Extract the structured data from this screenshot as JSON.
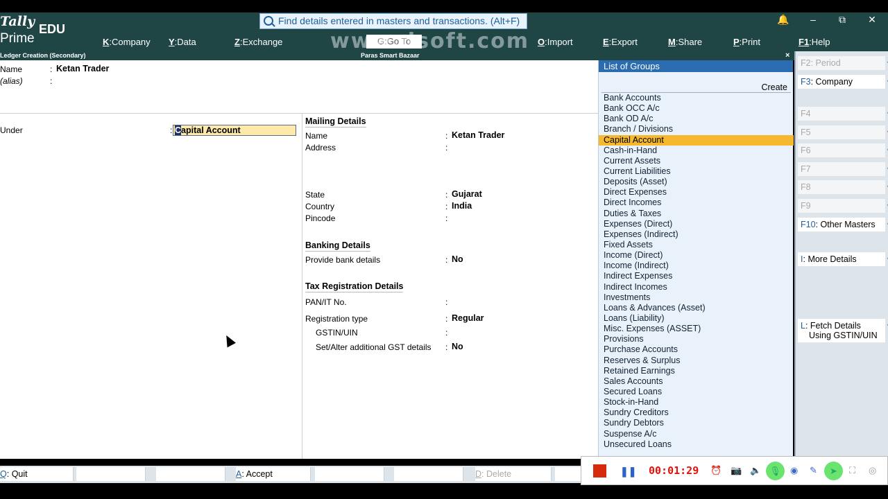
{
  "app": {
    "logo_top": "Tally",
    "logo_edu": "EDU",
    "logo_bottom": "Prime",
    "watermark": "www.dsoft.com"
  },
  "search": {
    "placeholder": "Find details entered in masters and transactions. (Alt+F)"
  },
  "window_controls": {
    "bell": "🔔",
    "minimize": "–",
    "restore": "⧉",
    "close": "✕"
  },
  "menu": [
    {
      "key": "K",
      "label": "Company"
    },
    {
      "key": "Y",
      "label": "Data"
    },
    {
      "key": "Z",
      "label": "Exchange"
    },
    {
      "key": "G",
      "label": "Go To"
    },
    {
      "key": "O",
      "label": "Import"
    },
    {
      "key": "E",
      "label": "Export"
    },
    {
      "key": "M",
      "label": "Share"
    },
    {
      "key": "P",
      "label": "Print"
    },
    {
      "key": "F1",
      "label": "Help"
    }
  ],
  "subheader": {
    "screen_title": "Ledger Creation (Secondary)",
    "company": "Paras Smart Bazaar",
    "close": "×"
  },
  "ledger": {
    "name_label": "Name",
    "name_value": "Ketan Trader",
    "alias_label": "(alias)",
    "under_label": "Under",
    "under_value_first": "C",
    "under_value_rest": "apital Account"
  },
  "mailing": {
    "heading": "Mailing Details",
    "name_label": "Name",
    "name_value": "Ketan Trader",
    "address_label": "Address",
    "state_label": "State",
    "state_value": "Gujarat",
    "country_label": "Country",
    "country_value": "India",
    "pincode_label": "Pincode"
  },
  "banking": {
    "heading": "Banking Details",
    "provide_label": "Provide bank details",
    "provide_value": "No"
  },
  "tax": {
    "heading": "Tax Registration Details",
    "pan_label": "PAN/IT No.",
    "regtype_label": "Registration type",
    "regtype_value": "Regular",
    "gstin_label": "GSTIN/UIN",
    "gst_details_label": "Set/Alter additional GST details",
    "gst_details_value": "No"
  },
  "groups": {
    "title": "List of Groups",
    "create": "Create",
    "selected": "Capital Account",
    "items": [
      "Bank Accounts",
      "Bank OCC A/c",
      "Bank OD A/c",
      "Branch / Divisions",
      "Capital Account",
      "Cash-in-Hand",
      "Current Assets",
      "Current Liabilities",
      "Deposits (Asset)",
      "Direct Expenses",
      "Direct Incomes",
      "Duties & Taxes",
      "Expenses (Direct)",
      "Expenses (Indirect)",
      "Fixed Assets",
      "Income (Direct)",
      "Income (Indirect)",
      "Indirect Expenses",
      "Indirect Incomes",
      "Investments",
      "Loans & Advances (Asset)",
      "Loans (Liability)",
      "Misc. Expenses (ASSET)",
      "Provisions",
      "Purchase Accounts",
      "Reserves & Surplus",
      "Retained Earnings",
      "Sales Accounts",
      "Secured Loans",
      "Stock-in-Hand",
      "Sundry Creditors",
      "Sundry Debtors",
      "Suspense A/c",
      "Unsecured Loans"
    ]
  },
  "right_buttons": [
    {
      "key": "F2",
      "label": "Period",
      "enabled": false
    },
    {
      "key": "F3",
      "label": "Company",
      "enabled": true
    },
    {
      "key": "F4",
      "label": "",
      "enabled": false
    },
    {
      "key": "F5",
      "label": "",
      "enabled": false
    },
    {
      "key": "F6",
      "label": "",
      "enabled": false
    },
    {
      "key": "F7",
      "label": "",
      "enabled": false
    },
    {
      "key": "F8",
      "label": "",
      "enabled": false
    },
    {
      "key": "F9",
      "label": "",
      "enabled": false
    },
    {
      "key": "F10",
      "label": "Other Masters",
      "enabled": true
    },
    {
      "key": "I",
      "label": "More Details",
      "enabled": true
    },
    {
      "key": "L",
      "label": "Fetch Details",
      "label2": "Using GSTIN/UIN",
      "enabled": true
    }
  ],
  "bottom_buttons": [
    {
      "key": "Q",
      "label": "Quit",
      "enabled": true
    },
    {
      "key": "A",
      "label": "Accept",
      "enabled": true
    },
    {
      "key": "D",
      "label": "Delete",
      "enabled": false
    }
  ],
  "recorder": {
    "time": "00:01:29"
  },
  "colors": {
    "header_bg": "#1f4645",
    "groups_title_bg": "#2b6bb0",
    "selected_bg": "#f5b82e",
    "field_bg": "#fdeaa8",
    "record_red": "#d62a0c"
  }
}
